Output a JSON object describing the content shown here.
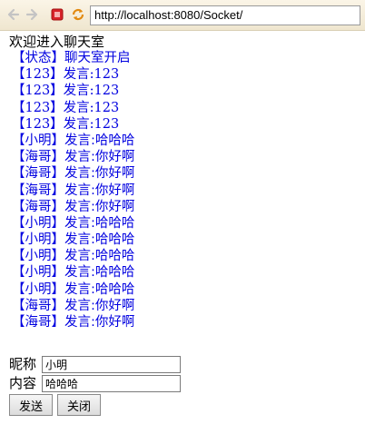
{
  "browser": {
    "url": "http://localhost:8080/Socket/",
    "icons": {
      "back": "back-arrow-icon",
      "forward": "forward-arrow-icon",
      "stop": "stop-icon",
      "refresh": "refresh-icon"
    }
  },
  "page": {
    "welcome": "欢迎进入聊天室",
    "messages": [
      "【状态】聊天室开启",
      "【123】发言:123",
      "【123】发言:123",
      "【123】发言:123",
      "【123】发言:123",
      "【小明】发言:哈哈哈",
      "【海哥】发言:你好啊",
      "【海哥】发言:你好啊",
      "【海哥】发言:你好啊",
      "【海哥】发言:你好啊",
      "【小明】发言:哈哈哈",
      "【小明】发言:哈哈哈",
      "【小明】发言:哈哈哈",
      "【小明】发言:哈哈哈",
      "【小明】发言:哈哈哈",
      "【海哥】发言:你好啊",
      "【海哥】发言:你好啊"
    ],
    "message_color": "#0000e0"
  },
  "form": {
    "nickname_label": "昵称",
    "nickname_value": "小明",
    "content_label": "内容",
    "content_value": "哈哈哈",
    "send_label": "发送",
    "close_label": "关闭"
  }
}
